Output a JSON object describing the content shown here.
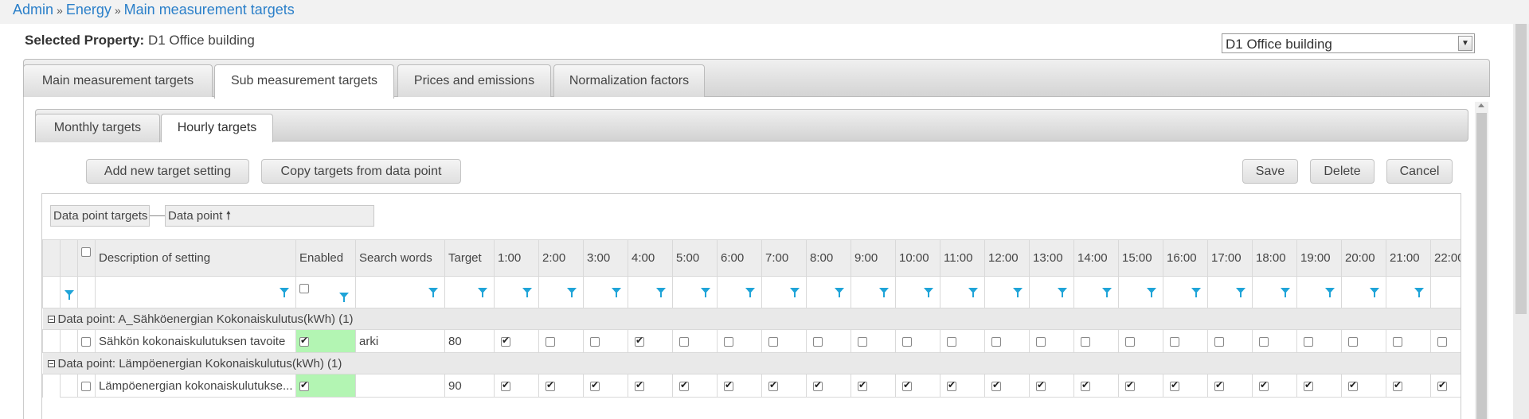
{
  "breadcrumb": {
    "items": [
      "Admin",
      "Energy",
      "Main measurement targets"
    ],
    "sep": "»"
  },
  "property": {
    "label": "Selected Property:",
    "value": "D1 Office building",
    "select_value": "D1 Office building"
  },
  "tabs": [
    "Main measurement targets",
    "Sub measurement targets",
    "Prices and emissions",
    "Normalization factors"
  ],
  "subtabs": [
    "Monthly targets",
    "Hourly targets"
  ],
  "buttons": {
    "add": "Add new target setting",
    "copy": "Copy targets from data point",
    "save": "Save",
    "delete": "Delete",
    "cancel": "Cancel"
  },
  "grouping": {
    "group1": "Data point targets",
    "group2": "Data point",
    "sort_arrow": "🠕"
  },
  "columns": {
    "description": "Description of setting",
    "enabled": "Enabled",
    "search": "Search words",
    "target": "Target",
    "hours": [
      "1:00",
      "2:00",
      "3:00",
      "4:00",
      "5:00",
      "6:00",
      "7:00",
      "8:00",
      "9:00",
      "10:00",
      "11:00",
      "12:00",
      "13:00",
      "14:00",
      "15:00",
      "16:00",
      "17:00",
      "18:00",
      "19:00",
      "20:00",
      "21:00",
      "22:00"
    ]
  },
  "groups": [
    {
      "title": "Data point: A_Sähköenergian Kokonaiskulutus(kWh) (1)",
      "row": {
        "description": "Sähkön kokonaiskulutuksen tavoite",
        "enabled": true,
        "search": "arki",
        "target": "80",
        "hours": [
          true,
          false,
          false,
          true,
          false,
          false,
          false,
          false,
          false,
          false,
          false,
          false,
          false,
          false,
          false,
          false,
          false,
          false,
          false,
          false,
          false,
          false
        ]
      }
    },
    {
      "title": "Data point: Lämpöenergian Kokonaiskulutus(kWh) (1)",
      "row": {
        "description": "Lämpöenergian kokonaiskulutukse...",
        "enabled": true,
        "search": "",
        "target": "90",
        "hours": [
          true,
          true,
          true,
          true,
          true,
          true,
          true,
          true,
          true,
          true,
          true,
          true,
          true,
          true,
          true,
          true,
          true,
          true,
          true,
          true,
          true,
          true
        ]
      }
    }
  ]
}
